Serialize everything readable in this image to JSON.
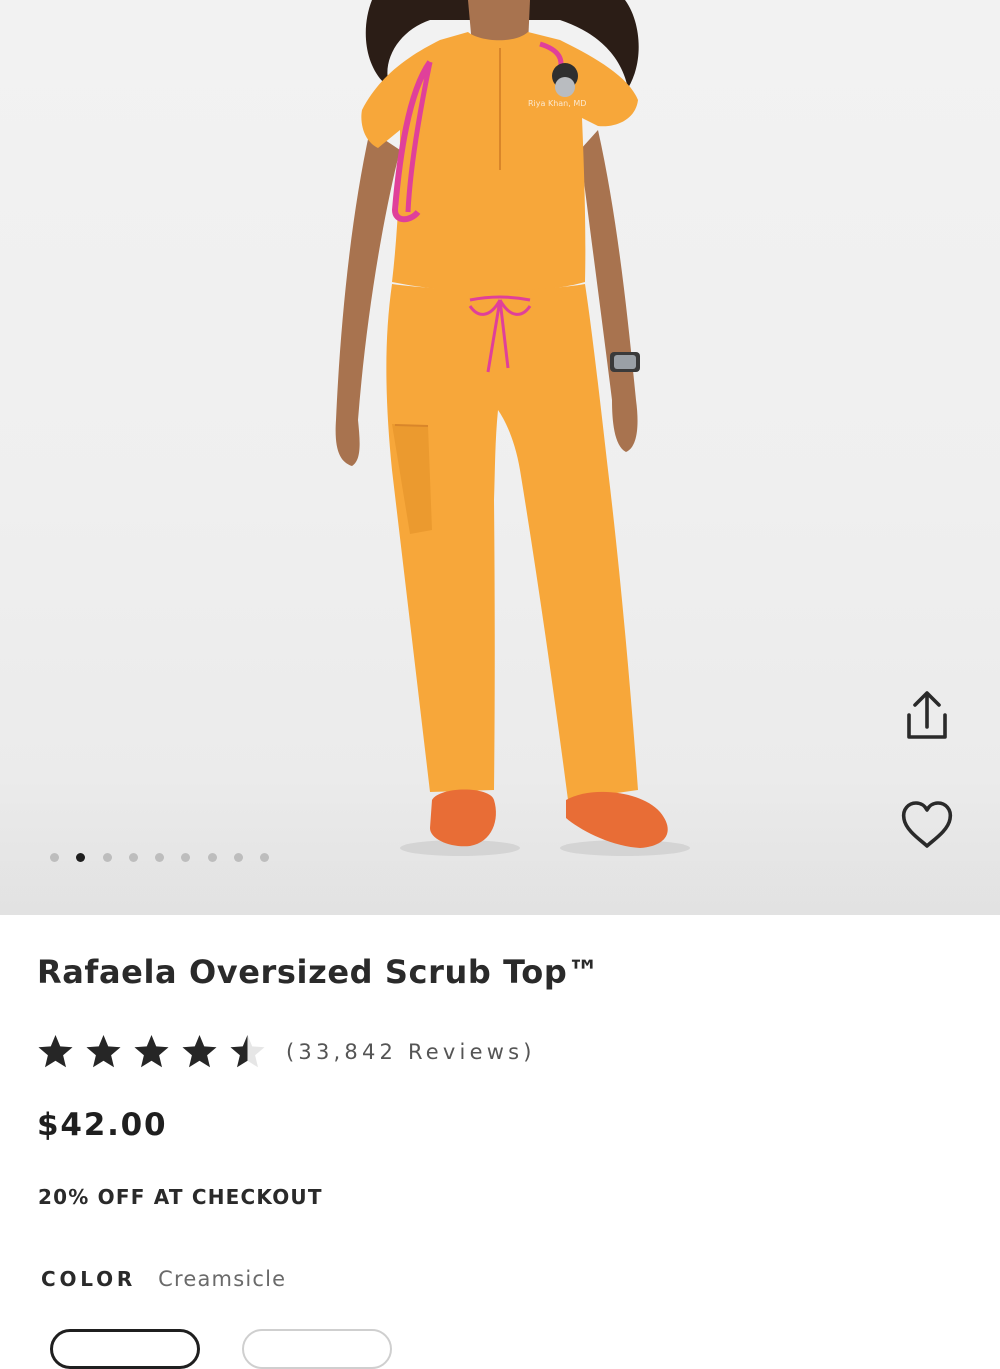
{
  "product": {
    "title": "Rafaela Oversized Scrub Top™",
    "rating_value": 4.5,
    "rating_max": 5,
    "reviews_label": "(33,842 Reviews)",
    "price": "$42.00",
    "promo": "20% OFF AT CHECKOUT",
    "color_label": "COLOR",
    "color_value": "Creamsicle"
  },
  "gallery": {
    "image_count": 9,
    "active_index": 1
  },
  "icons": {
    "share": "share-icon",
    "favorite": "heart-icon",
    "star": "star-icon"
  },
  "colors": {
    "scrub_orange": "#f7a73a",
    "accent_pink": "#e0409a",
    "text_dark": "#2a2a2a",
    "text_muted": "#6a6a6a",
    "dot_active": "#1f1f1f",
    "dot_inactive": "#bdbdbd"
  }
}
